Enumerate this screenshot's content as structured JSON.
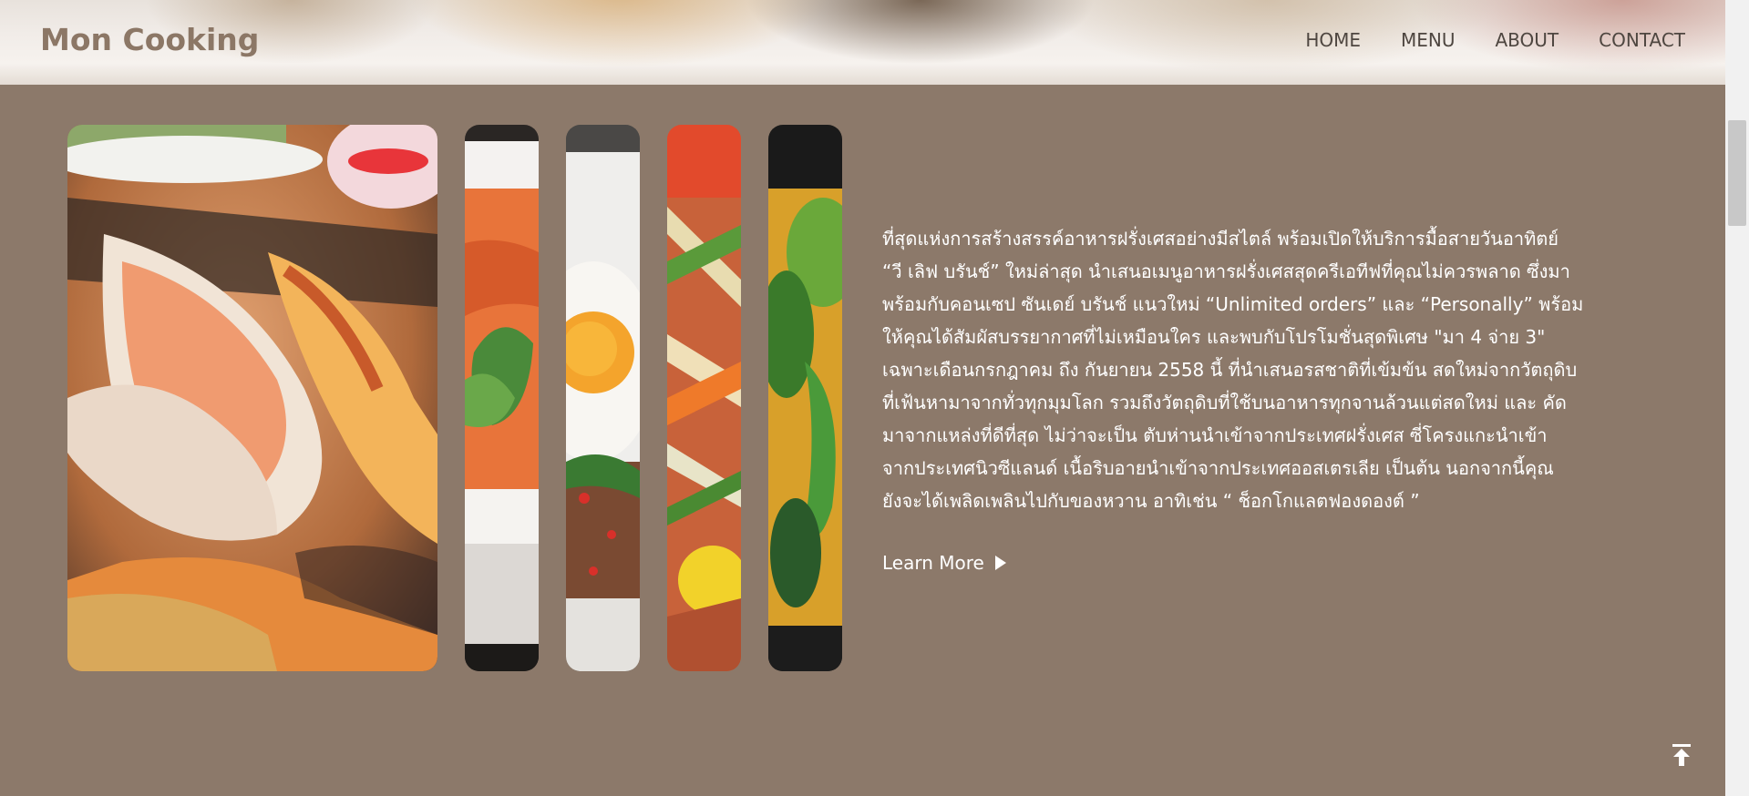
{
  "header": {
    "logo": "Mon Cooking",
    "nav": [
      {
        "label": "HOME"
      },
      {
        "label": "MENU"
      },
      {
        "label": "ABOUT"
      },
      {
        "label": "CONTACT"
      }
    ]
  },
  "gallery": {
    "images": [
      {
        "icon": "grilled-prawns-image"
      },
      {
        "icon": "tom-yum-soup-image"
      },
      {
        "icon": "basil-pork-fried-egg-image"
      },
      {
        "icon": "papaya-salad-image"
      },
      {
        "icon": "yellow-curry-image"
      }
    ]
  },
  "about": {
    "lines": [
      "ที่สุดแห่งการสร้างสรรค์อาหารฝรั่งเศสอย่างมีสไตล์ พร้อมเปิดให้บริการมื้อสายวันอาทิตย์",
      "“วี เลิฟ บรันช์” ใหม่ล่าสุด นำเสนอเมนูอาหารฝรั่งเศสสุดครีเอทีฟที่คุณไม่ควรพลาด ซึ่งมา",
      "พร้อมกับคอนเซป ซันเดย์ บรันช์ แนวใหม่ “Unlimited orders” และ “Personally” พร้อม",
      "ให้คุณได้สัมผัสบรรยากาศที่ไม่เหมือนใคร และพบกับโปรโมชั่นสุดพิเศษ \"มา 4 จ่าย 3\"",
      "เฉพาะเดือนกรกฎาคม ถึง กันยายน 2558 นี้ ที่นำเสนอรสชาติที่เข้มข้น สดใหม่จากวัตถุดิบ",
      "ที่เฟ้นหามาจากทั่วทุกมุมโลก รวมถึงวัตถุดิบที่ใช้บนอาหารทุกจานล้วนแต่สดใหม่ และ คัด",
      "มาจากแหล่งที่ดีที่สุด ไม่ว่าจะเป็น ตับห่านนำเข้าจากประเทศฝรั่งเศส ซี่โครงแกะนำเข้า",
      "จากประเทศนิวซีแลนด์ เนื้อริบอายนำเข้าจากประเทศออสเตรเลีย เป็นต้น นอกจากนี้คุณ",
      "ยังจะได้เพลิดเพลินไปกับของหวาน อาทิเช่น “ ช็อกโกแลตฟองดองต์ ”"
    ],
    "learn_more": "Learn More",
    "learn_more_icon": "play-triangle-icon"
  },
  "back_to_top": {
    "icon": "arrow-up-to-top-icon"
  },
  "colors": {
    "background": "#8c796a",
    "logo": "#8c7766",
    "nav_text": "#4e4640",
    "body_text": "#ffffff"
  }
}
